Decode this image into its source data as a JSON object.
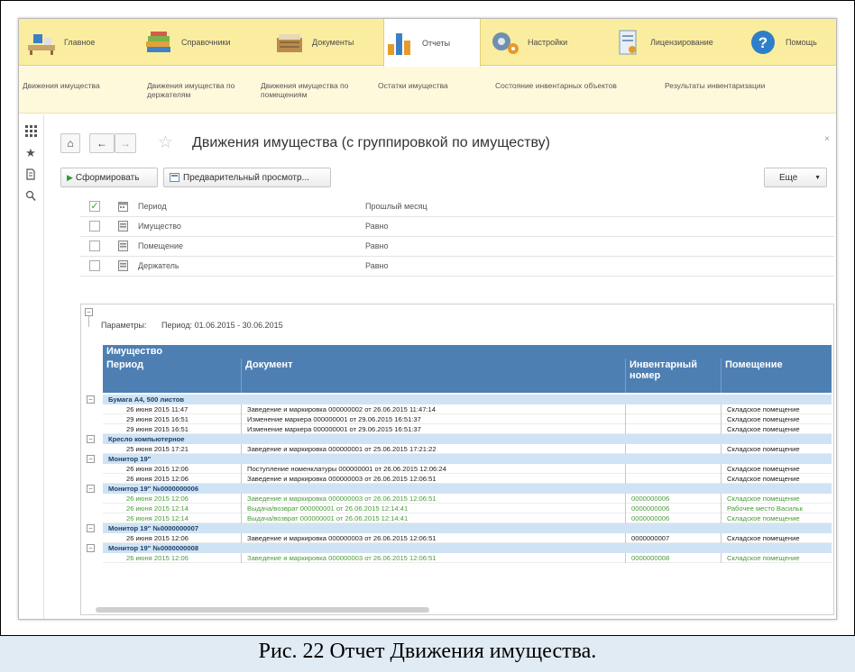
{
  "top_sections": [
    {
      "label": "Главное",
      "icon": "desk-icon"
    },
    {
      "label": "Справочники",
      "icon": "books-icon"
    },
    {
      "label": "Документы",
      "icon": "documents-icon"
    },
    {
      "label": "Отчеты",
      "icon": "bar-chart-icon",
      "active": true
    },
    {
      "label": "Настройки",
      "icon": "gears-icon"
    },
    {
      "label": "Лицензирование",
      "icon": "license-icon"
    },
    {
      "label": "Помощь",
      "icon": "help-icon"
    }
  ],
  "subnav": [
    "Движения имущества",
    "Движения имущества по держателям",
    "Движения имущества по помещениям",
    "Остатки имущества",
    "Состояние инвентарных объектов",
    "Результаты инвентаризации"
  ],
  "form": {
    "title": "Движения имущества (с группировкой по имуществу)",
    "close": "×",
    "home": "⌂",
    "back": "←",
    "forward": "→",
    "star": "☆"
  },
  "toolbar": {
    "generate": "Сформировать",
    "preview": "Предварительный просмотр...",
    "more": "Еще"
  },
  "filters": [
    {
      "name": "Период",
      "value": "Прошлый месяц",
      "checked": true
    },
    {
      "name": "Имущество",
      "value": "Равно",
      "checked": false
    },
    {
      "name": "Помещение",
      "value": "Равно",
      "checked": false
    },
    {
      "name": "Держатель",
      "value": "Равно",
      "checked": false
    }
  ],
  "report": {
    "params_label": "Параметры:",
    "params_value": "Период: 01.06.2015 - 30.06.2015",
    "group_header": "Имущество",
    "columns": [
      "Период",
      "Документ",
      "Инвентарный номер",
      "Помещение"
    ],
    "groups": [
      {
        "name": "Бумага А4, 500 листов",
        "rows": [
          {
            "period": "26 июня 2015 11:47",
            "doc": "Заведение и маркировка 000000002 от 26.06.2015 11:47:14",
            "inv": "",
            "room": "Складское помещение",
            "green": false
          },
          {
            "period": "29 июня 2015 16:51",
            "doc": "Изменение маркера 000000001 от 29.06.2015 16:51:37",
            "inv": "",
            "room": "Складское помещение",
            "green": false
          },
          {
            "period": "29 июня 2015 16:51",
            "doc": "Изменение маркера 000000001 от 29.06.2015 16:51:37",
            "inv": "",
            "room": "Складское помещение",
            "green": false
          }
        ]
      },
      {
        "name": "Кресло компьютерное",
        "rows": [
          {
            "period": "25 июня 2015 17:21",
            "doc": "Заведение и маркировка 000000001 от 25.06.2015 17:21:22",
            "inv": "",
            "room": "Складское помещение",
            "green": false
          }
        ]
      },
      {
        "name": "Монитор 19\"",
        "rows": [
          {
            "period": "26 июня 2015 12:06",
            "doc": "Поступление номенклатуры 000000001 от 26.06.2015 12:06:24",
            "inv": "",
            "room": "Складское помещение",
            "green": false
          },
          {
            "period": "26 июня 2015 12:06",
            "doc": "Заведение и маркировка 000000003 от 26.06.2015 12:06:51",
            "inv": "",
            "room": "Складское помещение",
            "green": false
          }
        ]
      },
      {
        "name": "Монитор 19\" №0000000006",
        "rows": [
          {
            "period": "26 июня 2015 12:06",
            "doc": "Заведение и маркировка 000000003 от 26.06.2015 12:06:51",
            "inv": "0000000006",
            "room": "Складское помещение",
            "green": true
          },
          {
            "period": "26 июня 2015 12:14",
            "doc": "Выдача/возврат 000000001 от 26.06.2015 12:14:41",
            "inv": "0000000006",
            "room": "Рабочее место Васильк",
            "green": true
          },
          {
            "period": "26 июня 2015 12:14",
            "doc": "Выдача/возврат 000000001 от 26.06.2015 12:14:41",
            "inv": "0000000006",
            "room": "Складское помещение",
            "green": true
          }
        ]
      },
      {
        "name": "Монитор 19\" №0000000007",
        "rows": [
          {
            "period": "26 июня 2015 12:06",
            "doc": "Заведение и маркировка 000000003 от 26.06.2015 12:06:51",
            "inv": "0000000007",
            "room": "Складское помещение",
            "green": false
          }
        ]
      },
      {
        "name": "Монитор 19\" №0000000008",
        "rows": [
          {
            "period": "26 июня 2015 12:06",
            "doc": "Заведение и маркировка 000000003 от 26.06.2015 12:06:51",
            "inv": "0000000008",
            "room": "Складское помещение",
            "green": true
          }
        ]
      }
    ]
  },
  "caption": "Рис. 22 Отчет Движения имущества."
}
